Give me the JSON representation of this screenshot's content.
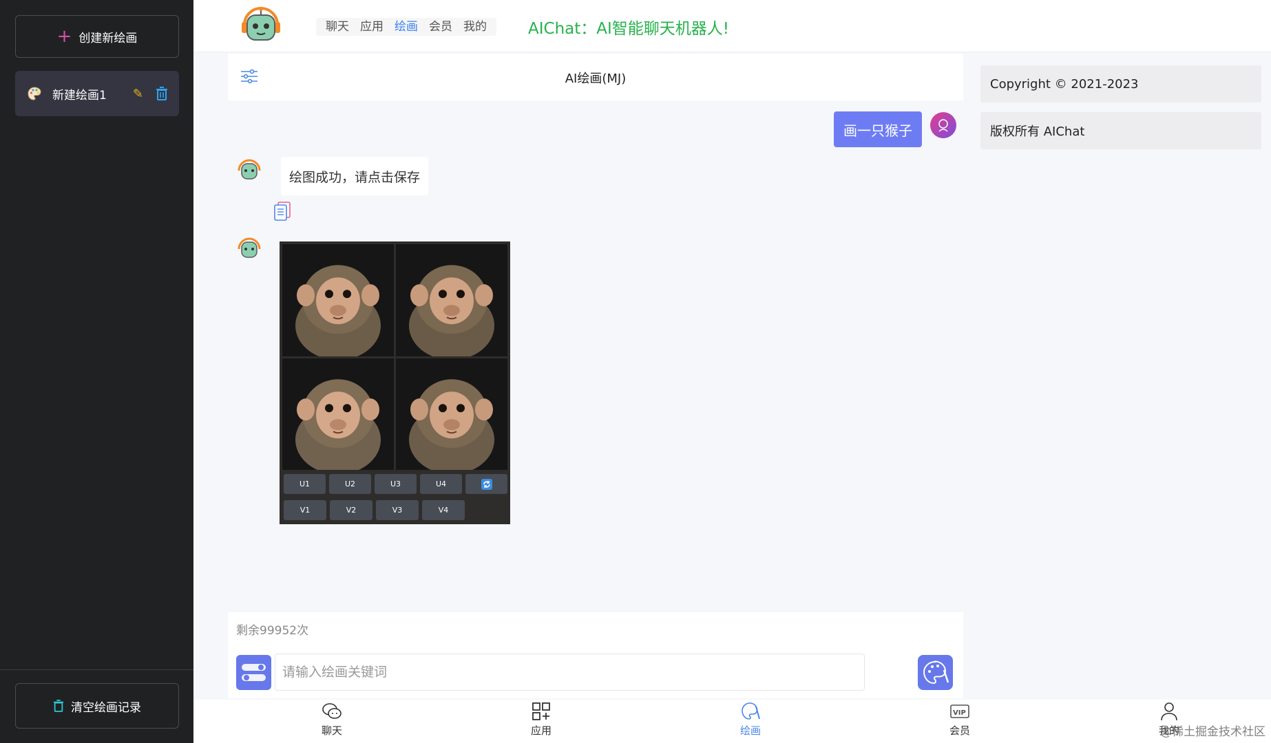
{
  "sidebar": {
    "new_label": "创建新绘画",
    "items": [
      {
        "label": "新建绘画1"
      }
    ],
    "clear_label": "清空绘画记录"
  },
  "header": {
    "nav": [
      "聊天",
      "应用",
      "绘画",
      "会员",
      "我的"
    ],
    "active_nav": "绘画",
    "brand": "AIChat：AI智能聊天机器人!"
  },
  "chat": {
    "title": "AI绘画(MJ)",
    "user_message": "画一只猴子",
    "bot_message": "绘图成功，请点击保存",
    "buttons_row1": [
      "U1",
      "U2",
      "U3",
      "U4"
    ],
    "buttons_row2": [
      "V1",
      "V2",
      "V3",
      "V4"
    ]
  },
  "input": {
    "remaining": "剩余99952次",
    "placeholder": "请输入绘画关键词"
  },
  "info": {
    "copyright": "Copyright © 2021-2023",
    "rights": "版权所有 AIChat"
  },
  "tabbar": {
    "tabs": [
      "聊天",
      "应用",
      "绘画",
      "会员",
      "我的"
    ],
    "active": "绘画"
  },
  "watermark": "@稀土掘金技术社区",
  "colors": {
    "sidebar_bg": "#202123",
    "accent": "#6e7cf4",
    "brand_green": "#26b24c",
    "active_blue": "#4a86e8"
  }
}
